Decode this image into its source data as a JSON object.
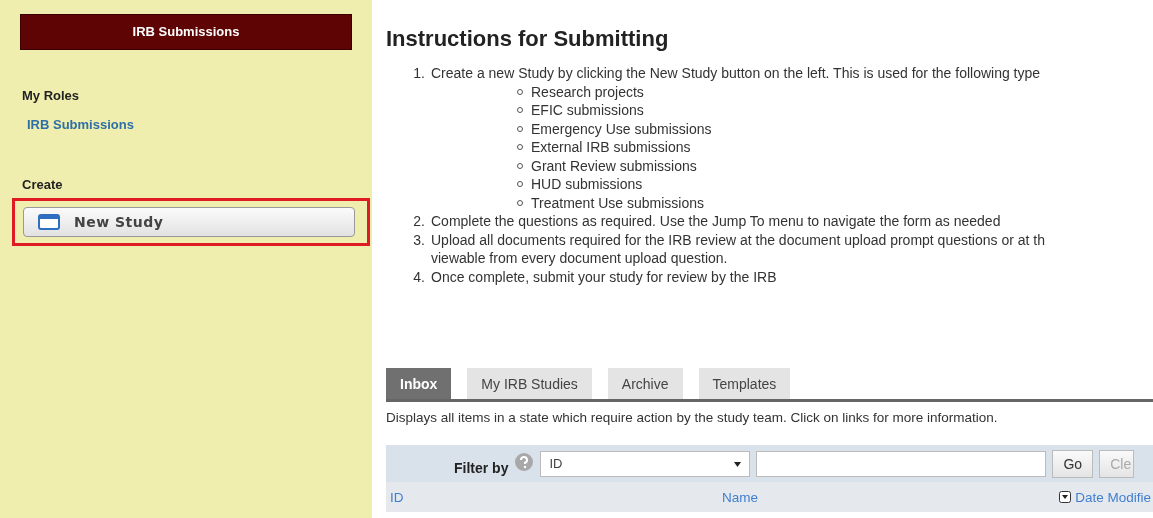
{
  "sidebar": {
    "title": "IRB Submissions",
    "sections": [
      {
        "heading": "My Roles",
        "items": [
          {
            "kind": "link",
            "label": "IRB Submissions"
          }
        ]
      },
      {
        "heading": "Create",
        "items": [
          {
            "kind": "button",
            "label": "New Study",
            "highlighted": true
          }
        ]
      }
    ]
  },
  "main": {
    "title": "Instructions for Submitting",
    "steps": [
      {
        "number": "1.",
        "lines": [
          "Create a new Study by clicking the New Study button on the left. This is used for the following type"
        ],
        "subitems": [
          "Research projects",
          "EFIC submissions",
          "Emergency Use submissions",
          "External IRB submissions",
          "Grant Review submissions",
          "HUD submissions",
          "Treatment Use submissions"
        ]
      },
      {
        "number": "2.",
        "lines": [
          "Complete the questions as required. Use the Jump To menu to navigate the form as needed"
        ]
      },
      {
        "number": "3.",
        "lines": [
          "Upload all documents required for the IRB review at the document upload prompt questions or at th",
          "viewable from every document upload question."
        ]
      },
      {
        "number": "4.",
        "lines": [
          "Once complete, submit your study for review by the IRB"
        ]
      }
    ],
    "tabs": [
      {
        "label": "Inbox",
        "selected": true
      },
      {
        "label": "My IRB Studies",
        "selected": false
      },
      {
        "label": "Archive",
        "selected": false
      },
      {
        "label": "Templates",
        "selected": false
      }
    ],
    "tab_description": "Displays all items in a state which require action by the study team. Click on links for more information.",
    "filter": {
      "label": "Filter by",
      "field": "ID",
      "buttons": [
        "Go",
        "Cle"
      ]
    },
    "table": {
      "columns": [
        {
          "label": "ID",
          "sort": false
        },
        {
          "label": "Name",
          "sort": false
        },
        {
          "label": "Date Modifie",
          "sort": true
        }
      ]
    }
  }
}
